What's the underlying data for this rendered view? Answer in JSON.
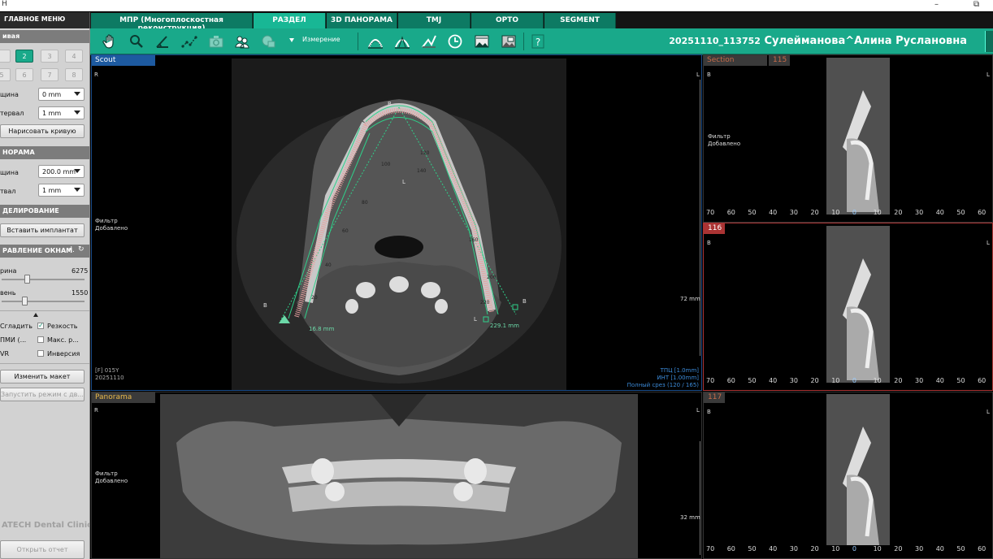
{
  "window": {
    "title": "Н"
  },
  "mainmenu": "ГЛАВНОЕ МЕНЮ",
  "tabs": [
    {
      "label": "МПР (Многоплоскостная реконструкция)"
    },
    {
      "label": "РАЗДЕЛ"
    },
    {
      "label": "3D ПАНОРАМА"
    },
    {
      "label": "TMJ"
    },
    {
      "label": "ОРТО"
    },
    {
      "label": "SEGMENT"
    }
  ],
  "toolbar": {
    "measure_label": "Измерение",
    "icons": [
      "hand-icon",
      "zoom-icon",
      "angle-icon",
      "polyline-icon",
      "camera-icon",
      "users-icon",
      "screen-capture-icon",
      "panorama-curve-icon",
      "panorama-curve-alt-icon",
      "angle-measure-icon",
      "clock-icon",
      "image-icon",
      "image-alt-icon",
      "help-icon"
    ]
  },
  "patient": {
    "id": "20251110_113752",
    "name": "Сулейманова^Алина Руслановна"
  },
  "left": {
    "sec_curve": "ивая",
    "numbers": [
      "",
      "2",
      "3",
      "4",
      "5",
      "6",
      "7",
      "8"
    ],
    "thickness_label": "щина",
    "thickness_value": "0 mm",
    "interval_label": "тервал",
    "interval_value": "1 mm",
    "draw_curve": "Нарисовать кривую",
    "sec_panorama": "НОРАМА",
    "pano_thickness_label": "щина",
    "pano_thickness_value": "200.0 mm",
    "pano_interval_label": "твал",
    "pano_interval_value": "1 mm",
    "sec_modeling": "ДЕЛИРОВАНИЕ",
    "insert_implant": "Вставить имплантат",
    "sec_window": "РАВЛЕНИЕ ОКНАМ",
    "width_label": "рина",
    "width_value": "6275",
    "level_label": "вень",
    "level_value": "1550",
    "smooth": "Сгладить",
    "sharp": "Резкость",
    "mip": "ПМИ (...",
    "max": "Макс. р...",
    "vr": "VR",
    "invert": "Инверсия",
    "change_layout": "Изменить макет",
    "run_mode": "Запустить режим с дв...",
    "clinic": "ATECH Dental Clinic",
    "open_report": "Открыть отчет"
  },
  "scout": {
    "label": "Scout",
    "R": "R",
    "L": "L",
    "B": "B",
    "L2": "L",
    "filter1": "Фильтр",
    "filter2": "Добавлено",
    "ruler_label": "72 mm",
    "meas_left": "16.8 mm",
    "meas_right": "229.1 mm",
    "arch_labels": [
      "100",
      "120",
      "140",
      "80",
      "160",
      "60",
      "180",
      "40",
      "200",
      "20",
      "220"
    ],
    "info1": "[F] 015Y",
    "info2": "20251110",
    "cyan1": "ТПЦ [1.0mm]",
    "cyan2": "ИНТ [1.00mm]",
    "cyan3": "Полный срез (120 / 165)"
  },
  "panorama": {
    "label": "Panorama",
    "R": "R",
    "L": "L",
    "filter1": "Фильтр",
    "filter2": "Добавлено",
    "ruler_label": "32 mm"
  },
  "sections": [
    {
      "label": "Section",
      "num": "115"
    },
    {
      "label": "",
      "num": "116"
    },
    {
      "label": "",
      "num": "117"
    }
  ],
  "section_common": {
    "B": "B",
    "L": "L",
    "filter1": "Фильтр",
    "filter2": "Добавлено",
    "scale": [
      "70",
      "60",
      "50",
      "40",
      "30",
      "20",
      "10",
      "0",
      "10",
      "20",
      "30",
      "40",
      "50",
      "60"
    ]
  }
}
